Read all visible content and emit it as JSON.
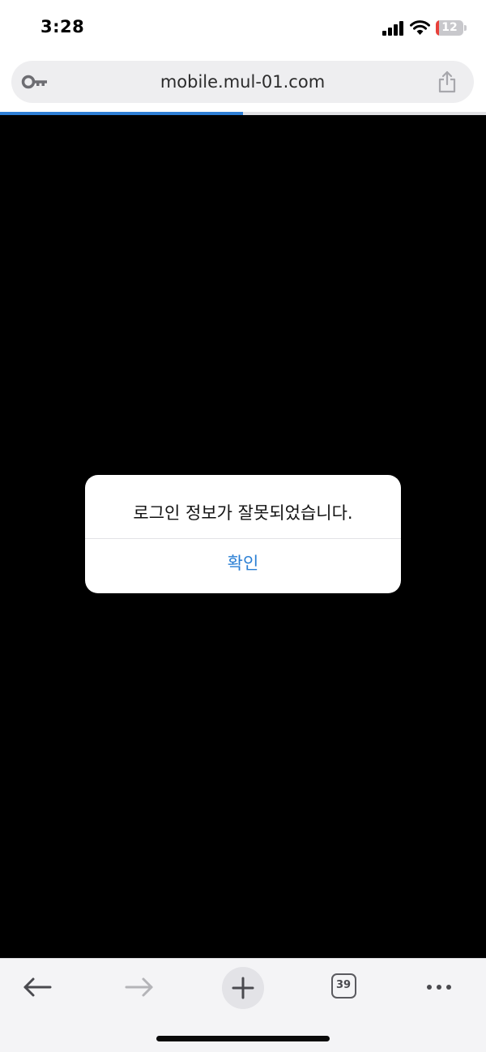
{
  "status_bar": {
    "time": "3:28",
    "battery_level": "12",
    "battery_fraction": 0.12,
    "battery_color": "#e8403a",
    "icons": [
      "signal-icon",
      "wifi-icon",
      "battery-icon"
    ]
  },
  "address_bar": {
    "url": "mobile.mul-01.com",
    "left_icon": "key-icon",
    "right_icon": "share-icon"
  },
  "page_load_progress": 0.5,
  "colors": {
    "accent": "#2a7fd4",
    "page_background": "#000000",
    "dialog_background": "#ffffff"
  },
  "alert": {
    "message": "로그인 정보가 잘못되었습니다.",
    "confirm_label": "확인"
  },
  "toolbar": {
    "tab_count": "39",
    "icons": [
      "back-arrow-icon",
      "forward-arrow-icon",
      "plus-icon",
      "tabs-icon",
      "more-icon"
    ]
  }
}
